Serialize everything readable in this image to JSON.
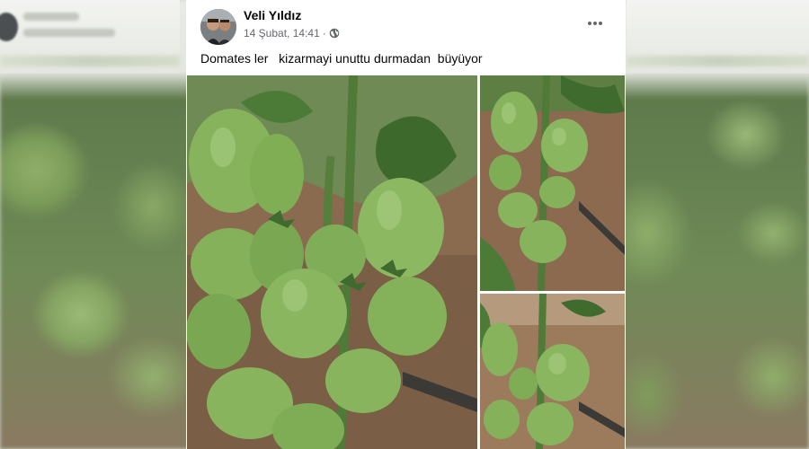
{
  "post": {
    "author": "Veli Yıldız",
    "timestamp": "14 Şubat, 14:41",
    "separator": "·",
    "privacy_icon": "globe-icon",
    "more_icon": "more-horizontal-icon",
    "caption": "Domates ler   kizarmayi unuttu durmadan  büyüyor"
  },
  "photos": [
    {
      "subject": "green-tomato-cluster-large"
    },
    {
      "subject": "green-tomato-cluster-top-right"
    },
    {
      "subject": "green-tomato-cluster-bottom-right"
    }
  ],
  "colors": {
    "card_bg": "#ffffff",
    "author_text": "#050505",
    "meta_text": "#65676b",
    "tomato_green": "#86b35c",
    "leaf_green": "#3f6b2f",
    "soil": "#8b6a4f"
  }
}
